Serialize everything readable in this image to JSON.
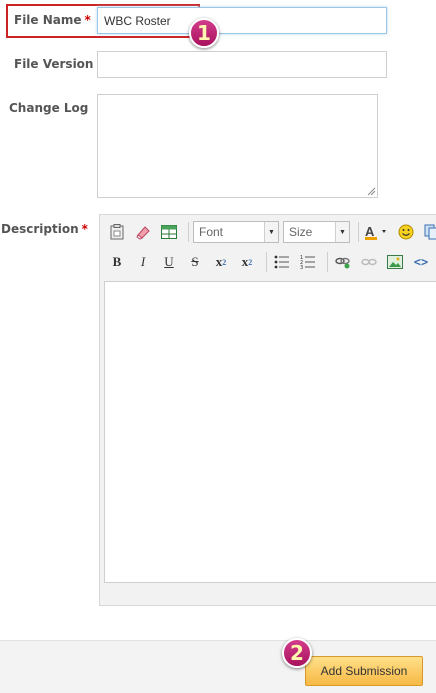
{
  "form": {
    "file_name": {
      "label": "File Name",
      "required_mark": "*",
      "value": "WBC Roster"
    },
    "file_version": {
      "label": "File Version",
      "value": ""
    },
    "change_log": {
      "label": "Change Log",
      "value": ""
    },
    "description": {
      "label": "Description",
      "required_mark": "*"
    }
  },
  "editor": {
    "font_select": "Font",
    "size_select": "Size",
    "bold": "B",
    "italic": "I",
    "underline": "U",
    "strikethrough": "S",
    "subscript": "x",
    "subscript_sub": "2",
    "superscript": "x",
    "superscript_sup": "2"
  },
  "annotations": {
    "step1": "1",
    "step2": "2"
  },
  "footer": {
    "submit_label": "Add Submission"
  },
  "colors": {
    "required": "#cc0000",
    "highlight_border": "#cc2222",
    "badge": "#b81a6a",
    "submit_button": "#f9c45a"
  }
}
